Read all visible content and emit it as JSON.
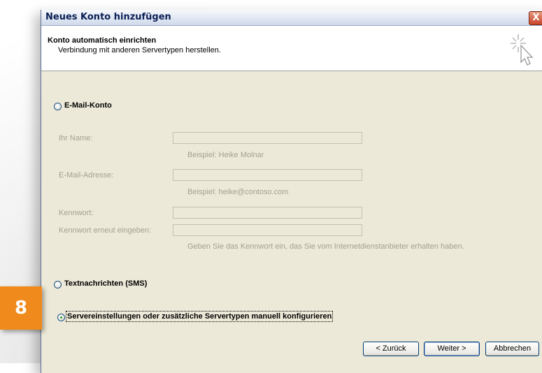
{
  "window": {
    "title": "Neues Konto hinzufügen",
    "close_glyph": "X"
  },
  "header": {
    "title": "Konto automatisch einrichten",
    "subtitle": "Verbindung mit anderen Servertypen herstellen.",
    "icon": "cursor-sparkle-icon"
  },
  "options": {
    "email": {
      "label": "E-Mail-Konto",
      "selected": false
    },
    "sms": {
      "label": "Textnachrichten (SMS)",
      "selected": false
    },
    "manual": {
      "label": "Servereinstellungen oder zusätzliche Servertypen manuell konfigurieren",
      "selected": true
    }
  },
  "fields": {
    "name": {
      "label": "Ihr Name:",
      "value": "",
      "hint": "Beispiel: Heike Molnar"
    },
    "email": {
      "label": "E-Mail-Adresse:",
      "value": "",
      "hint": "Beispiel: heike@contoso.com"
    },
    "password": {
      "label": "Kennwort:",
      "value": ""
    },
    "password_repeat": {
      "label": "Kennwort erneut eingeben:",
      "value": ""
    },
    "password_hint": "Geben Sie das Kennwort ein, das Sie vom Internetdienstanbieter erhalten haben."
  },
  "buttons": {
    "back": "< Zurück",
    "next": "Weiter >",
    "cancel": "Abbrechen"
  },
  "marker": {
    "number": "8",
    "color": "#f08a1c"
  }
}
